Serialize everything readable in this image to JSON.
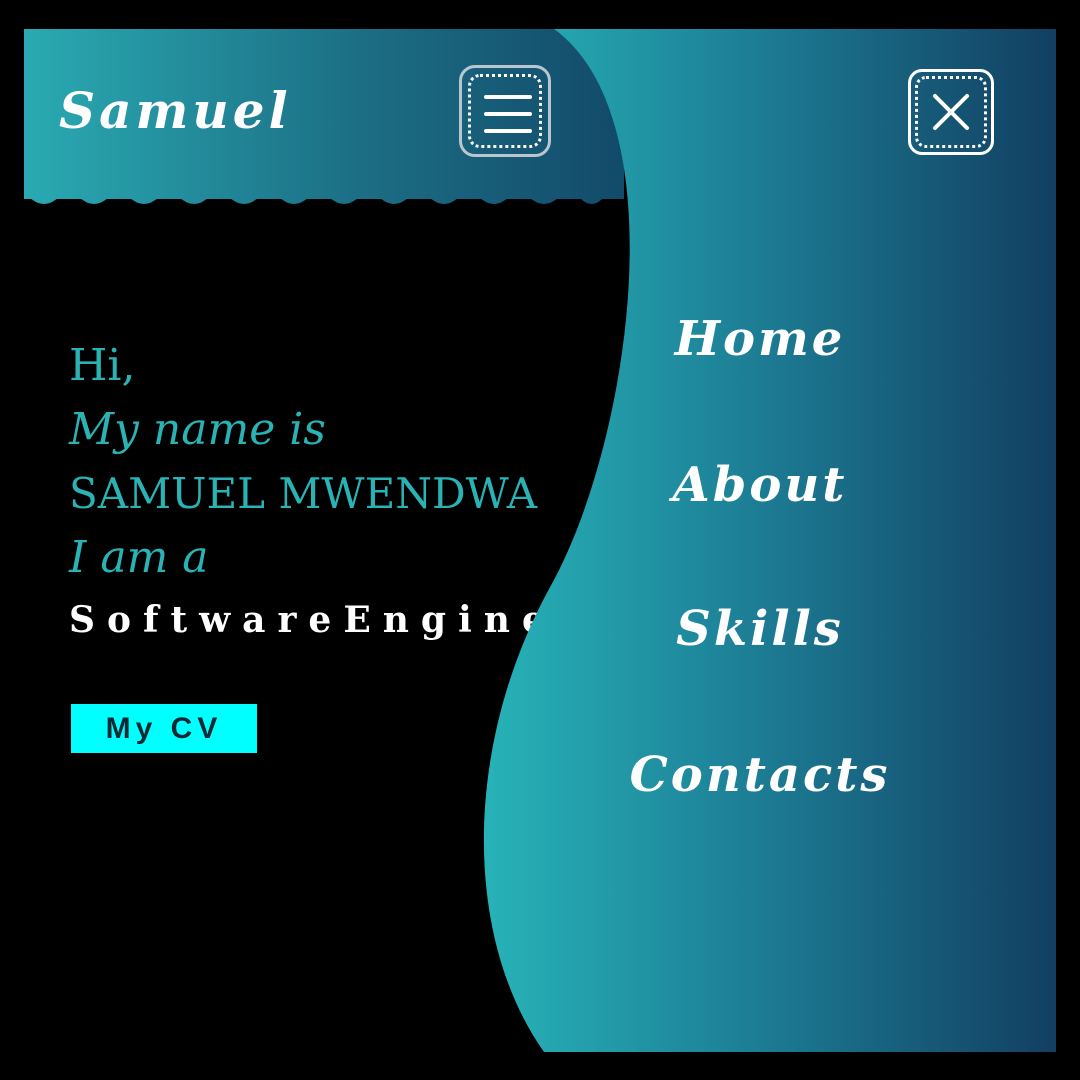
{
  "header": {
    "brand": "Samuel",
    "menu_icon": "hamburger-icon"
  },
  "hero": {
    "greeting": "Hi,",
    "name_intro": "My name is",
    "full_name": "SAMUEL MWENDWA",
    "role_intro": "I am a",
    "typed_role": "SoftwareEngine",
    "cv_button": "My CV"
  },
  "nav_menu": {
    "close_icon": "close-icon",
    "items": [
      {
        "label": "Home"
      },
      {
        "label": "About"
      },
      {
        "label": "Skills"
      },
      {
        "label": "Contacts"
      }
    ]
  },
  "colors": {
    "accent": "#2ab3b5",
    "cv_button_bg": "#00ffff",
    "gradient_light": "#2aaab2",
    "gradient_dark": "#124a6a",
    "background": "#000000"
  }
}
